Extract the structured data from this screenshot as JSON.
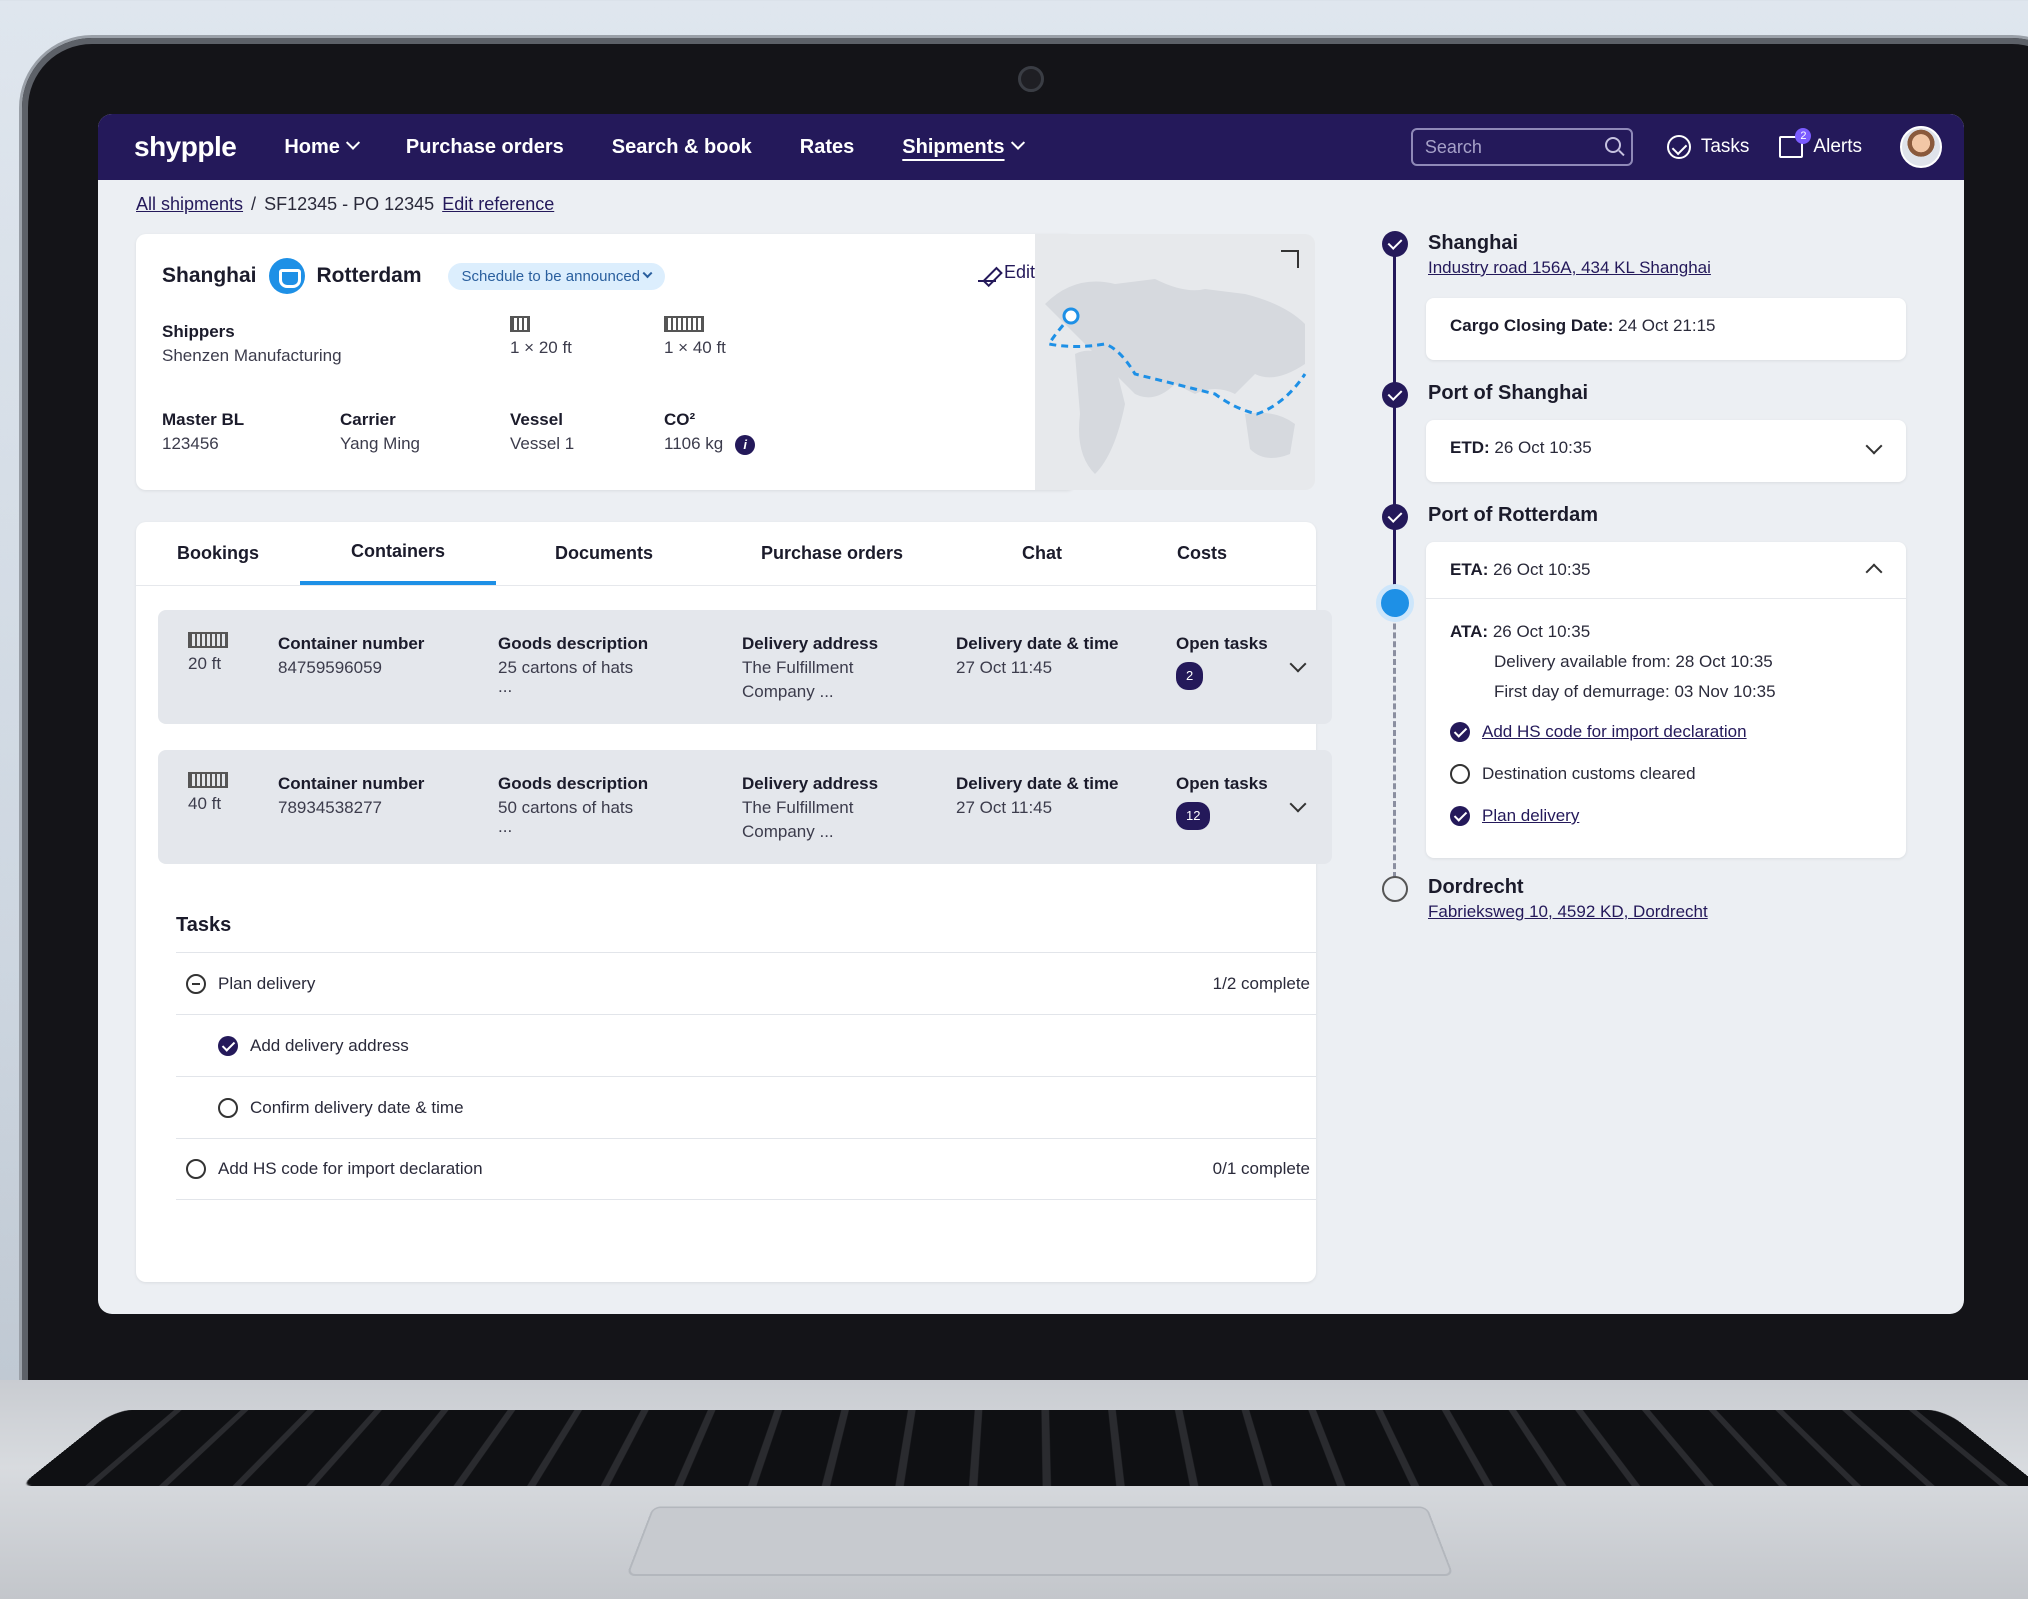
{
  "nav": {
    "logo": "shypple",
    "items": [
      {
        "label": "Home",
        "dropdown": true
      },
      {
        "label": "Purchase orders",
        "dropdown": false
      },
      {
        "label": "Search & book",
        "dropdown": false
      },
      {
        "label": "Rates",
        "dropdown": false
      },
      {
        "label": "Shipments",
        "dropdown": true
      }
    ],
    "search_placeholder": "Search",
    "tasks_label": "Tasks",
    "alerts_label": "Alerts",
    "alerts_count": "2"
  },
  "breadcrumb": {
    "root": "All shipments",
    "separator": "/",
    "current": "SF12345 - PO 12345",
    "edit_reference": "Edit reference"
  },
  "route": {
    "origin": "Shanghai",
    "destination": "Rotterdam",
    "schedule_status": "Schedule to be announced",
    "edit_label": "Edit",
    "shippers_label": "Shippers",
    "shippers_value": "Shenzen Manufacturing",
    "container_small": "1 × 20 ft",
    "container_large": "1 × 40 ft",
    "master_bl_label": "Master BL",
    "master_bl_value": "123456",
    "carrier_label": "Carrier",
    "carrier_value": "Yang Ming",
    "vessel_label": "Vessel",
    "vessel_value": "Vessel 1",
    "co2_label": "CO²",
    "co2_value": "1106 kg"
  },
  "tabs": [
    "Bookings",
    "Containers",
    "Documents",
    "Purchase orders",
    "Chat",
    "Costs"
  ],
  "active_tab": "Containers",
  "containers": [
    {
      "size": "20 ft",
      "number_label": "Container number",
      "number": "84759596059",
      "goods_label": "Goods description",
      "goods": "25 cartons of hats",
      "goods_more": "...",
      "address_label": "Delivery address",
      "address": "The Fulfillment",
      "address_more": "Company ...",
      "date_label": "Delivery date & time",
      "date": "27 Oct 11:45",
      "tasks_label": "Open tasks",
      "tasks_count": "2"
    },
    {
      "size": "40 ft",
      "number_label": "Container number",
      "number": "78934538277",
      "goods_label": "Goods description",
      "goods": "50 cartons of hats",
      "goods_more": "...",
      "address_label": "Delivery address",
      "address": "The Fulfillment",
      "address_more": "Company ...",
      "date_label": "Delivery date & time",
      "date": "27 Oct 11:45",
      "tasks_label": "Open tasks",
      "tasks_count": "12"
    }
  ],
  "tasks": {
    "title": "Tasks",
    "items": [
      {
        "label": "Plan delivery",
        "status": "1/2 complete"
      },
      {
        "label": "Add delivery address"
      },
      {
        "label": "Confirm delivery date & time"
      },
      {
        "label": "Add HS code for import declaration",
        "status": "0/1 complete"
      }
    ]
  },
  "timeline": {
    "stops": [
      {
        "title": "Shanghai",
        "address": "Industry road 156A, 434 KL Shanghai"
      },
      {
        "title": "Port of Shanghai"
      },
      {
        "title": "Port of Rotterdam"
      },
      {
        "title": "Dordrecht",
        "address": "Fabrieksweg 10, 4592 KD, Dordrecht"
      }
    ],
    "cargo_closing_label": "Cargo Closing Date:",
    "cargo_closing_value": "24 Oct 21:15",
    "etd_label": "ETD:",
    "etd_value": "26 Oct 10:35",
    "eta_label": "ETA:",
    "eta_value": "26 Oct 10:35",
    "ata_label": "ATA:",
    "ata_value": "26 Oct 10:35",
    "delivery_available": "Delivery available from: 28 Oct 10:35",
    "demurrage": "First day of demurrage: 03 Nov 10:35",
    "subtasks": [
      {
        "label": "Add HS code for import declaration",
        "done": true
      },
      {
        "label": "Destination customs cleared",
        "done": false
      },
      {
        "label": "Plan delivery",
        "done": true
      }
    ]
  },
  "colors": {
    "nav_bg": "#24195a",
    "accent": "#1e90e6",
    "page_bg": "#eceff3"
  }
}
